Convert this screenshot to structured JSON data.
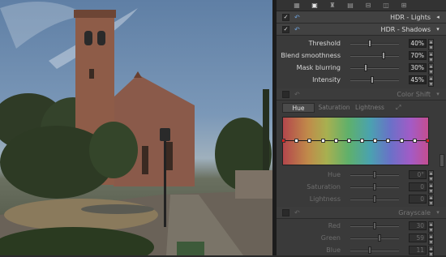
{
  "toolbar": {
    "icons": [
      "layers-icon",
      "document-icon",
      "stamp-icon",
      "grid-icon",
      "sliders-icon",
      "camera-icon",
      "tone-icon"
    ]
  },
  "hdr_lights": {
    "title": "HDR - Lights",
    "enabled": true,
    "arrow": "◂"
  },
  "hdr_shadows": {
    "title": "HDR - Shadows",
    "enabled": true,
    "arrow": "▾",
    "params": [
      {
        "label": "Threshold",
        "value": "40%",
        "level": 0.4
      },
      {
        "label": "Blend smoothness",
        "value": "70%",
        "level": 0.7
      },
      {
        "label": "Mask blurring",
        "value": "30%",
        "level": 0.3
      },
      {
        "label": "Intensity",
        "value": "45%",
        "level": 0.45
      }
    ]
  },
  "color_shift": {
    "title": "Color Shift",
    "enabled": false,
    "arrow": "▾",
    "tabs": [
      "Hue",
      "Saturation",
      "Lightness"
    ],
    "active_tab": "Hue",
    "control_points": 12,
    "params": [
      {
        "label": "Hue",
        "value": "0°",
        "level": 0.5
      },
      {
        "label": "Saturation",
        "value": "0",
        "level": 0.5
      },
      {
        "label": "Lightness",
        "value": "0",
        "level": 0.5
      }
    ]
  },
  "grayscale": {
    "title": "Grayscale",
    "enabled": false,
    "arrow": "▾",
    "params": [
      {
        "label": "Red",
        "value": "30",
        "level": 0.5
      },
      {
        "label": "Green",
        "value": "59",
        "level": 0.6
      },
      {
        "label": "Blue",
        "value": "11",
        "level": 0.4
      }
    ]
  },
  "colors": {
    "panel": "#3a3a3a",
    "accent": "#6ea0d8",
    "endpoint": "#d62020"
  }
}
